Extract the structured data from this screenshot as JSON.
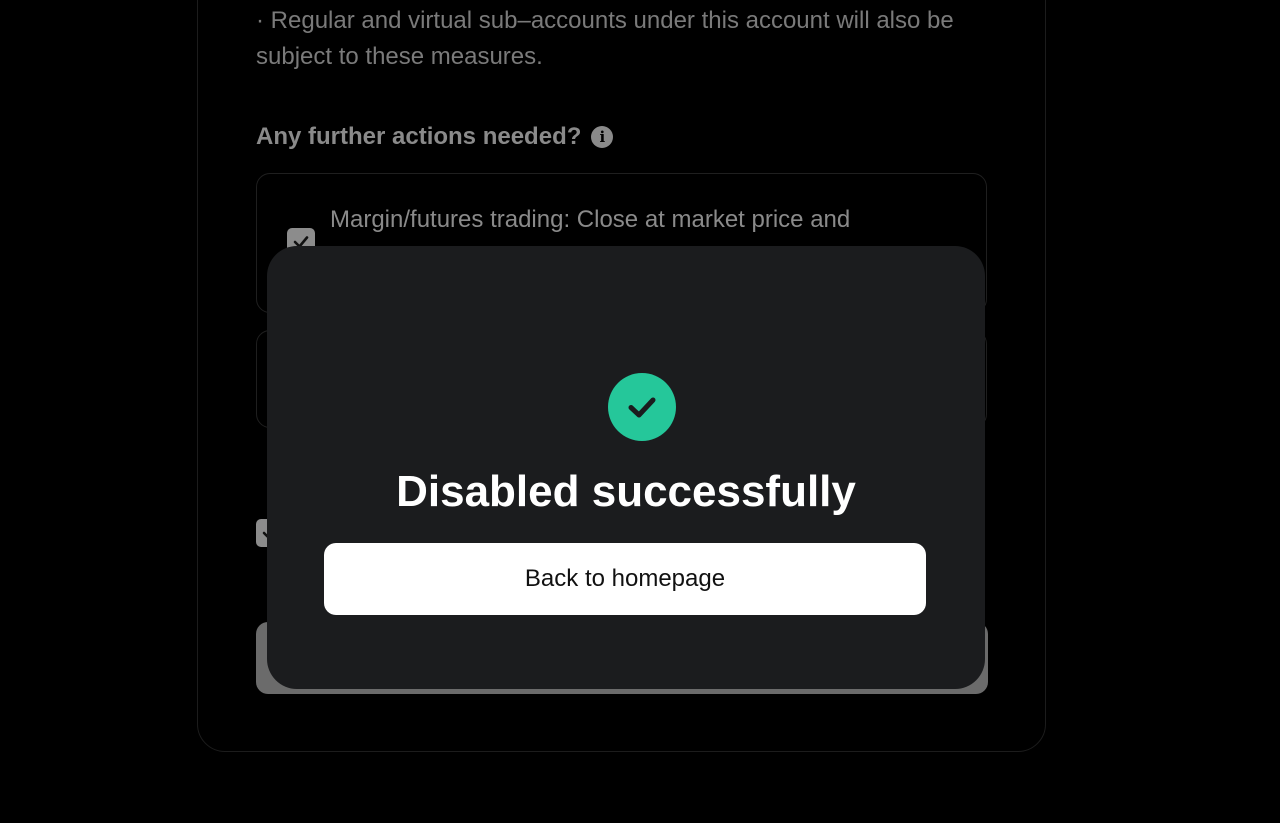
{
  "background": {
    "notice_text": "· Regular and virtual sub–accounts under this account will also be subject to these measures.",
    "section_title": "Any further actions needed?",
    "option_1_text": "Margin/futures trading: Close at market price and"
  },
  "modal": {
    "title": "Disabled successfully",
    "button_label": "Back to homepage",
    "icon": "check-circle-icon"
  },
  "colors": {
    "success": "#25c79a",
    "modal_bg": "#1b1c1e",
    "button_bg": "#ffffff"
  }
}
